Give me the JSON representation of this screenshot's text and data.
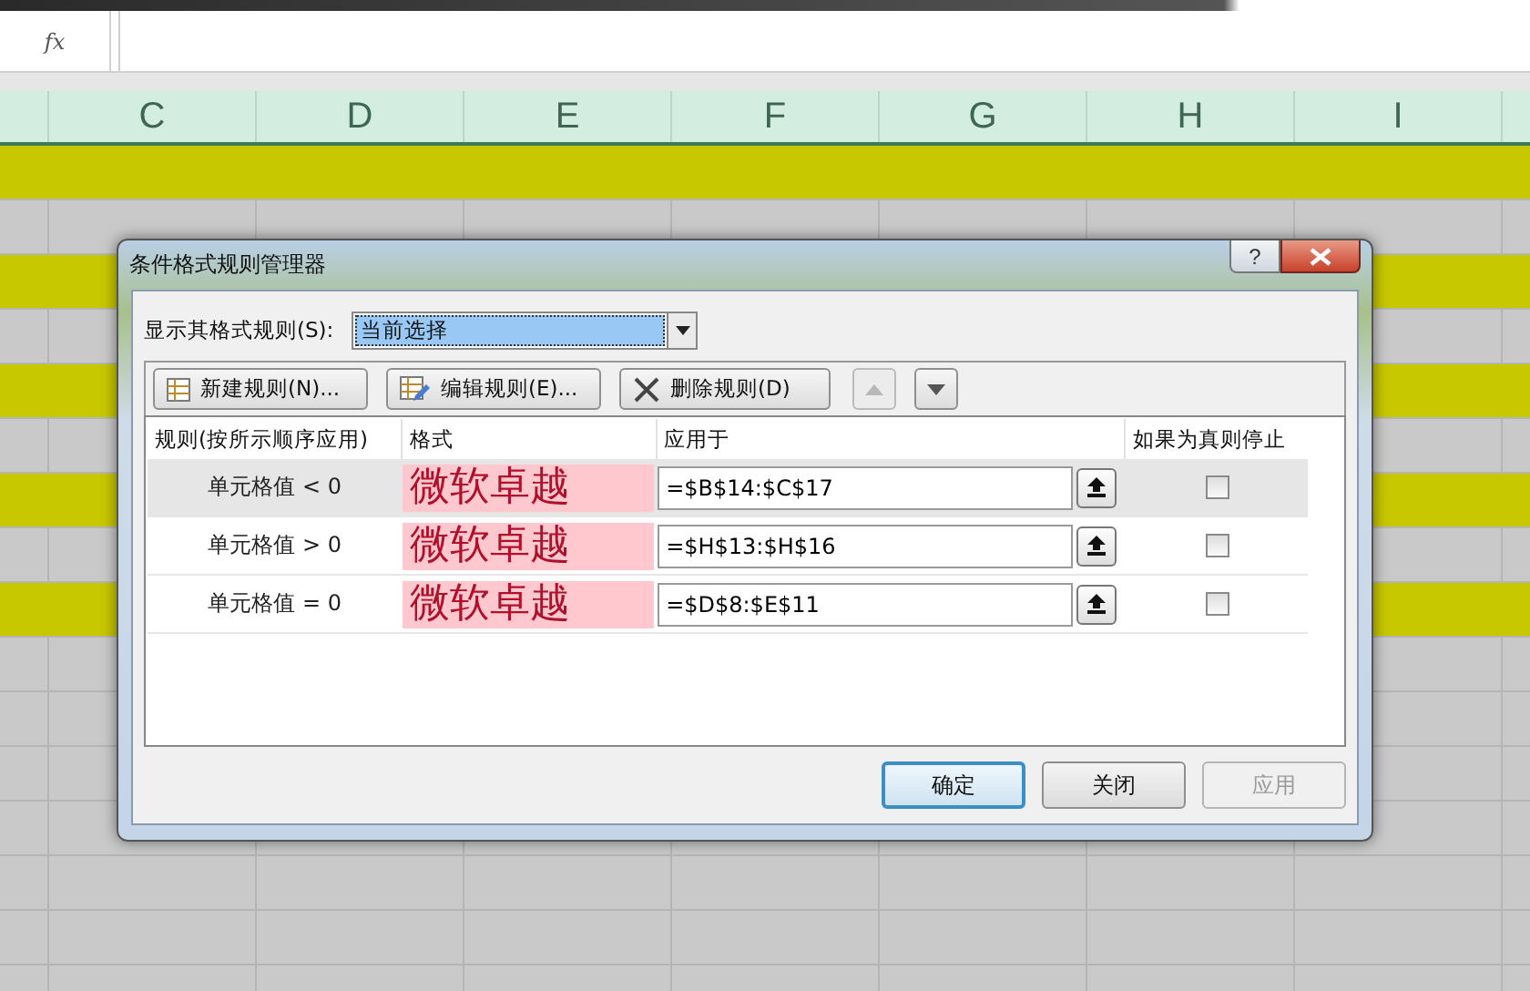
{
  "formula_bar": {
    "function_label": "fx"
  },
  "spreadsheet": {
    "columns": [
      "C",
      "D",
      "E",
      "F",
      "G",
      "H",
      "I"
    ],
    "rows": [
      {
        "filled": true
      },
      {
        "filled": false
      },
      {
        "filled": true
      },
      {
        "filled": false
      },
      {
        "filled": true
      },
      {
        "filled": false
      },
      {
        "filled": true
      },
      {
        "filled": false
      },
      {
        "filled": true
      },
      {
        "filled": false
      },
      {
        "filled": false
      },
      {
        "filled": false
      },
      {
        "filled": false
      },
      {
        "filled": false
      },
      {
        "filled": false
      },
      {
        "filled": false
      }
    ]
  },
  "dialog": {
    "title": "条件格式规则管理器",
    "help": "?",
    "show_rules": {
      "label": "显示其格式规则(S):",
      "value": "当前选择"
    },
    "toolbar": [
      {
        "kind": "new",
        "label": "新建规则(N)...",
        "disabled": false
      },
      {
        "kind": "edit",
        "label": "编辑规则(E)...",
        "disabled": false
      },
      {
        "kind": "delete",
        "label": "删除规则(D)",
        "disabled": false
      },
      {
        "kind": "up",
        "disabled": true
      },
      {
        "kind": "down",
        "disabled": false
      }
    ],
    "columns": [
      "规则(按所示顺序应用)",
      "格式",
      "应用于",
      "如果为真则停止"
    ],
    "rules": [
      {
        "rule": "单元格值 < 0",
        "format": "微软卓越",
        "applies_to": "=$B$14:$C$17",
        "stop_if_true": false,
        "selected": true
      },
      {
        "rule": "单元格值 > 0",
        "format": "微软卓越",
        "applies_to": "=$H$13:$H$16",
        "stop_if_true": false,
        "selected": false
      },
      {
        "rule": "单元格值 = 0",
        "format": "微软卓越",
        "applies_to": "=$D$8:$E$11",
        "stop_if_true": false,
        "selected": false
      }
    ],
    "buttons": [
      {
        "label": "确定",
        "default": true,
        "disabled": false
      },
      {
        "label": "关闭",
        "default": false,
        "disabled": false
      },
      {
        "label": "应用",
        "default": false,
        "disabled": true
      }
    ]
  }
}
